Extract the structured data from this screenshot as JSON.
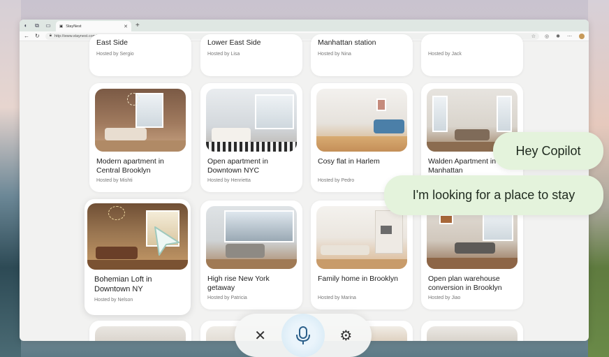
{
  "browser": {
    "tab_title": "StayNest",
    "url": "http://www.staynest.com/search/"
  },
  "listings_top": [
    {
      "title": "East Side",
      "host": "Hosted by Sergio"
    },
    {
      "title": "Lower East Side",
      "host": "Hosted by Lisa"
    },
    {
      "title": "Manhattan station",
      "host": "Hosted by Nina"
    },
    {
      "title": "",
      "host": "Hosted by Jack"
    }
  ],
  "listings_row2": [
    {
      "title": "Modern apartment in Central Brooklyn",
      "host": "Hosted by Mishti"
    },
    {
      "title": "Open apartment in Downtown NYC",
      "host": "Hosted by Henrietta"
    },
    {
      "title": "Cosy flat in Harlem",
      "host": "Hosted by Pedro"
    },
    {
      "title": "Walden Apartment in Manhattan",
      "host": ""
    }
  ],
  "listings_row3": [
    {
      "title": "Bohemian Loft in Downtown NY",
      "host": "Hosted by Nelson"
    },
    {
      "title": "High rise New York getaway",
      "host": "Hosted by Patricia"
    },
    {
      "title": "Family home in Brooklyn",
      "host": "Hosted by Marina"
    },
    {
      "title": "Open plan warehouse conversion in Brooklyn",
      "host": "Hosted by Jiao"
    }
  ],
  "copilot": {
    "bubble_1": "Hey Copilot",
    "bubble_2": "I'm looking for a place to stay"
  },
  "voice_controls": {
    "close_icon": "close-icon",
    "mic_icon": "microphone-icon",
    "settings_icon": "gear-icon"
  },
  "colors": {
    "bubble": "#e4f3dc",
    "mic_glow": "#cfe6f3",
    "tabbar": "#dfe7e3"
  }
}
